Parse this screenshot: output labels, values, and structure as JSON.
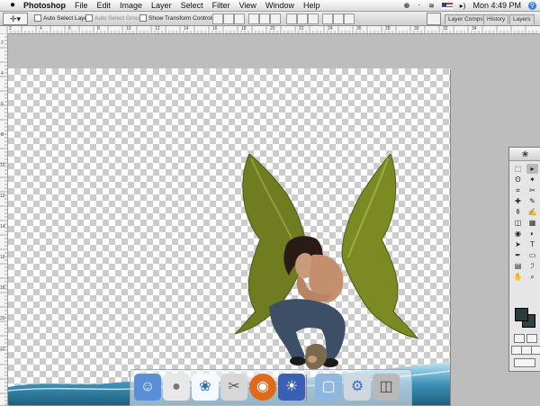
{
  "menubar": {
    "app_name": "Photoshop",
    "items": [
      "File",
      "Edit",
      "Image",
      "Layer",
      "Select",
      "Filter",
      "View",
      "Window",
      "Help"
    ],
    "clock": "Mon 4:49 PM"
  },
  "options_bar": {
    "auto_select_layer": "Auto Select Layer",
    "auto_select_groups": "Auto Select Groups",
    "show_transform_controls": "Show Transform Controls",
    "palette_tabs": [
      "Layer Comps",
      "History",
      "Layers"
    ]
  },
  "ruler": {
    "top_labels": [
      "2",
      "4",
      "6",
      "8",
      "10",
      "12",
      "14",
      "16",
      "18",
      "20",
      "22",
      "24",
      "26",
      "28",
      "30",
      "32",
      "34"
    ],
    "left_labels": [
      "2",
      "4",
      "6",
      "8",
      "10",
      "12",
      "14",
      "16",
      "18",
      "20",
      "22"
    ]
  },
  "toolbox": {
    "tools": [
      "marquee-tool",
      "move-tool",
      "lasso-tool",
      "magic-wand-tool",
      "crop-tool",
      "slice-tool",
      "healing-brush-tool",
      "brush-tool",
      "clone-stamp-tool",
      "history-brush-tool",
      "eraser-tool",
      "gradient-tool",
      "blur-tool",
      "dodge-tool",
      "path-selection-tool",
      "type-tool",
      "pen-tool",
      "shape-tool",
      "notes-tool",
      "eyedropper-tool",
      "hand-tool",
      "zoom-tool"
    ],
    "glyphs": [
      "⬚",
      "▸",
      "ʘ",
      "✦",
      "⌗",
      "✂",
      "✚",
      "✎",
      "⚱",
      "✍",
      "◫",
      "▦",
      "◉",
      "◐",
      "➤",
      "T",
      "✒",
      "▭",
      "▤",
      "ℐ",
      "✋",
      "⌕"
    ],
    "foreground_color": "#2c3b3c",
    "background_color": "#314244"
  },
  "dock": {
    "items": [
      "finder-icon",
      "apple-icon",
      "feather-app-icon",
      "preview-icon",
      "firefox-icon",
      "dashboard-icon",
      "screen-icon",
      "system-prefs-icon",
      "trash-icon"
    ]
  },
  "colors": {
    "menubar_bg": "#e8e8e8",
    "workspace_bg": "#bdbdbd",
    "accent": "#3d7fe0"
  }
}
